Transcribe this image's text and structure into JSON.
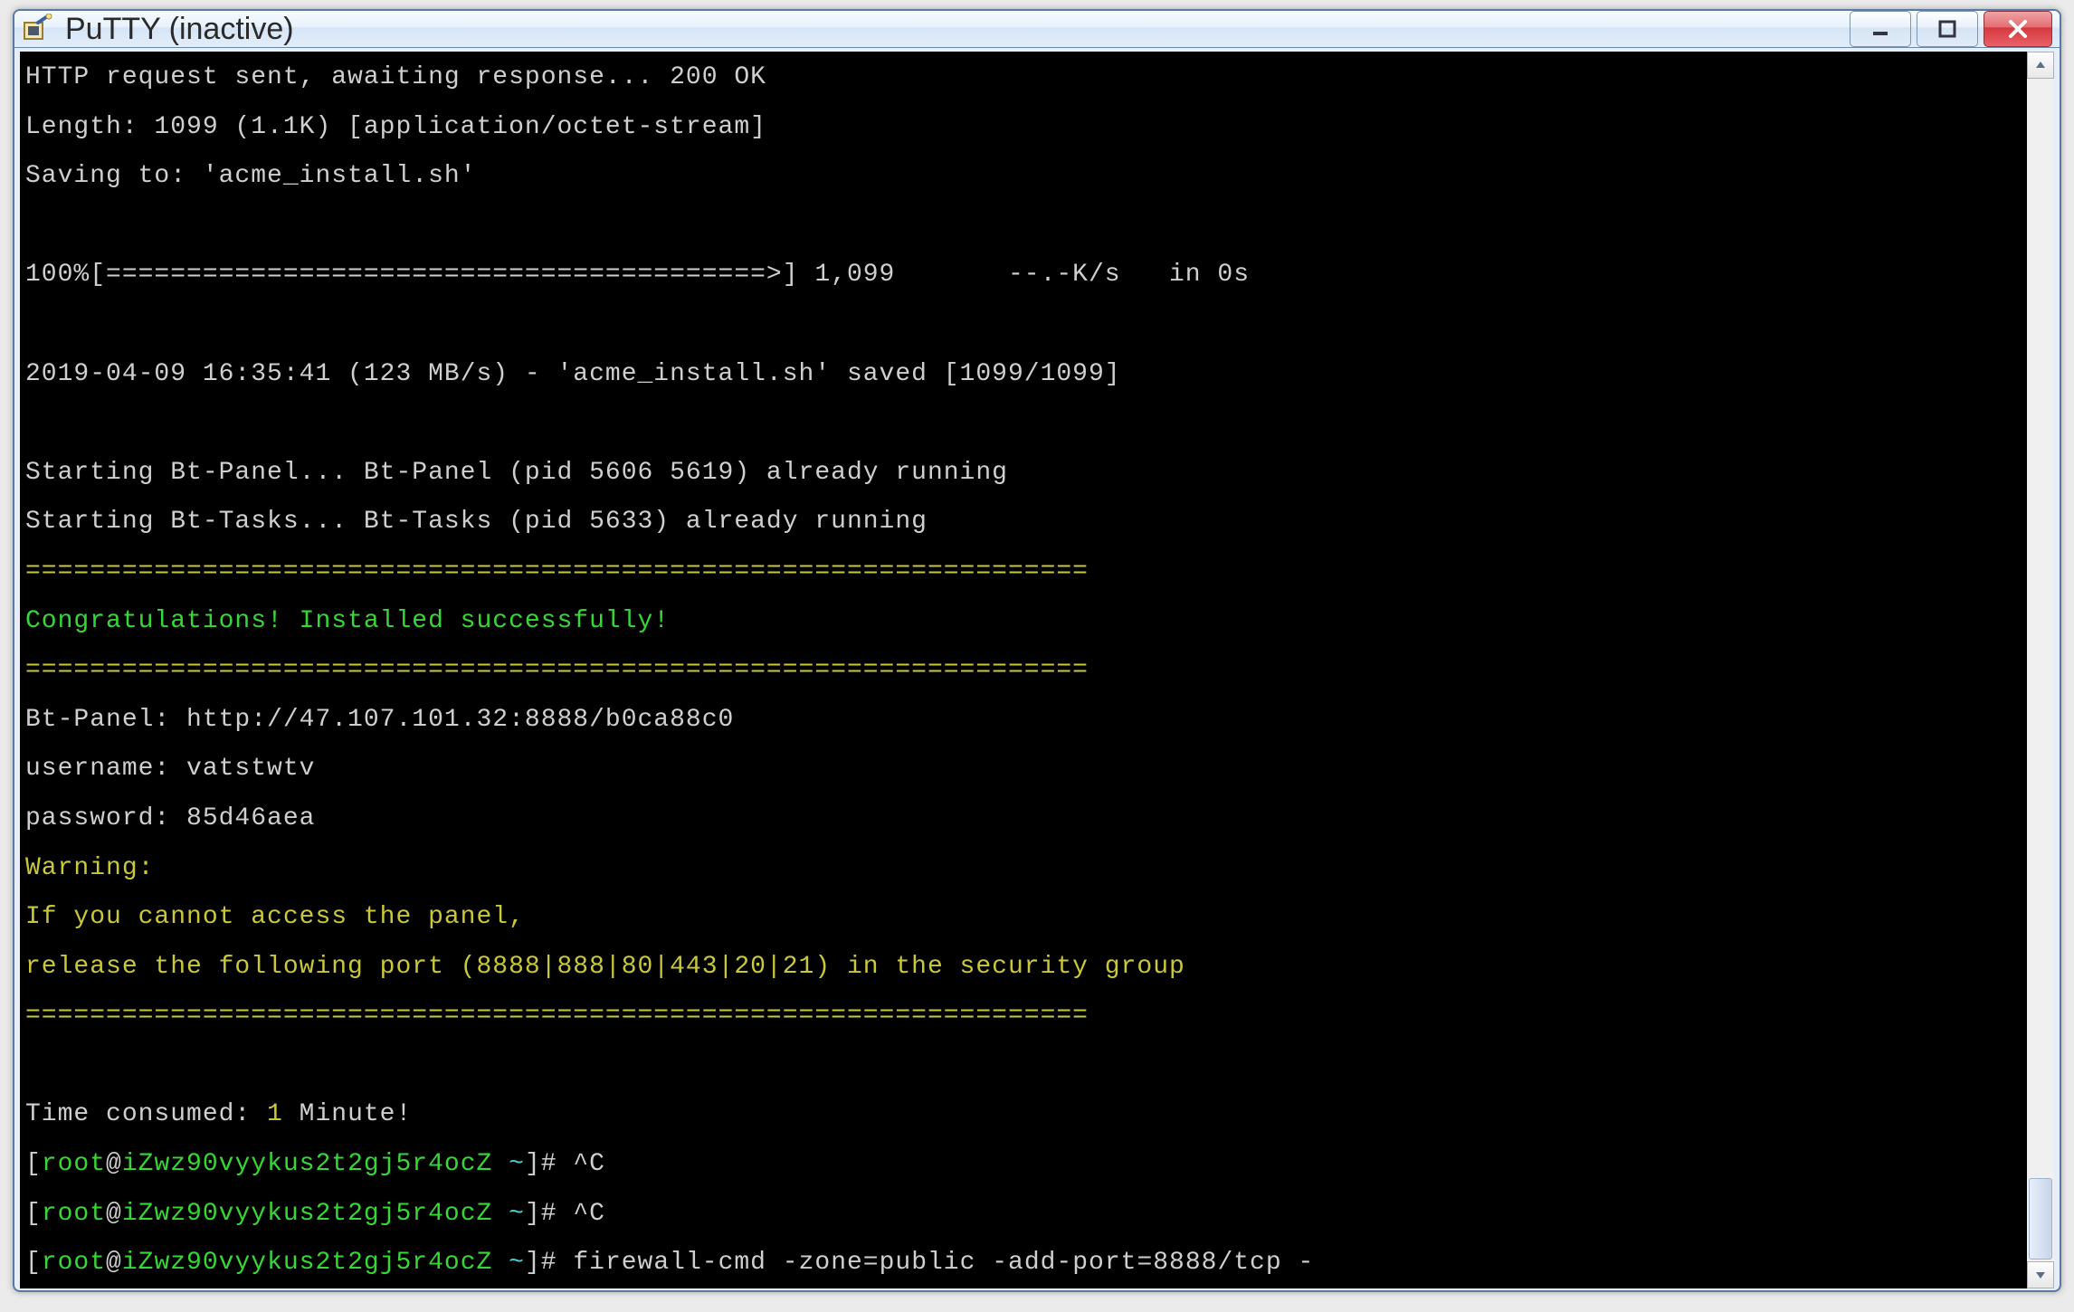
{
  "window": {
    "title": "PuTTY (inactive)"
  },
  "terminal": {
    "lines": [
      {
        "segments": [
          {
            "cls": "",
            "text": "HTTP request sent, awaiting response... 200 OK"
          }
        ]
      },
      {
        "segments": [
          {
            "cls": "",
            "text": "Length: 1099 (1.1K) [application/octet-stream]"
          }
        ]
      },
      {
        "segments": [
          {
            "cls": "",
            "text": "Saving to: 'acme_install.sh'"
          }
        ]
      },
      {
        "segments": [
          {
            "cls": "",
            "text": ""
          }
        ]
      },
      {
        "segments": [
          {
            "cls": "",
            "text": "100%[=========================================>] 1,099       --.-K/s   in 0s"
          }
        ]
      },
      {
        "segments": [
          {
            "cls": "",
            "text": ""
          }
        ]
      },
      {
        "segments": [
          {
            "cls": "",
            "text": "2019-04-09 16:35:41 (123 MB/s) - 'acme_install.sh' saved [1099/1099]"
          }
        ]
      },
      {
        "segments": [
          {
            "cls": "",
            "text": ""
          }
        ]
      },
      {
        "segments": [
          {
            "cls": "",
            "text": "Starting Bt-Panel... Bt-Panel (pid 5606 5619) already running"
          }
        ]
      },
      {
        "segments": [
          {
            "cls": "",
            "text": "Starting Bt-Tasks... Bt-Tasks (pid 5633) already running"
          }
        ]
      },
      {
        "segments": [
          {
            "cls": "y",
            "text": "=================================================================="
          }
        ]
      },
      {
        "segments": [
          {
            "cls": "g",
            "text": "Congratulations! Installed successfully!"
          }
        ]
      },
      {
        "segments": [
          {
            "cls": "y",
            "text": "=================================================================="
          }
        ]
      },
      {
        "segments": [
          {
            "cls": "",
            "text": "Bt-Panel: http://47.107.101.32:8888/b0ca88c0"
          }
        ]
      },
      {
        "segments": [
          {
            "cls": "",
            "text": "username: vatstwtv"
          }
        ]
      },
      {
        "segments": [
          {
            "cls": "",
            "text": "password: 85d46aea"
          }
        ]
      },
      {
        "segments": [
          {
            "cls": "y",
            "text": "Warning:"
          }
        ]
      },
      {
        "segments": [
          {
            "cls": "y",
            "text": "If you cannot access the panel, "
          }
        ]
      },
      {
        "segments": [
          {
            "cls": "y",
            "text": "release the following port (8888|888|80|443|20|21) in the security group"
          }
        ]
      },
      {
        "segments": [
          {
            "cls": "y",
            "text": "=================================================================="
          }
        ]
      },
      {
        "segments": [
          {
            "cls": "",
            "text": ""
          }
        ]
      },
      {
        "segments": [
          {
            "cls": "",
            "text": "Time consumed: "
          },
          {
            "cls": "y",
            "text": "1"
          },
          {
            "cls": "",
            "text": " Minute!"
          }
        ]
      },
      {
        "segments": [
          {
            "cls": "",
            "text": "["
          },
          {
            "cls": "g",
            "text": "root"
          },
          {
            "cls": "",
            "text": "@"
          },
          {
            "cls": "g",
            "text": "iZwz90vyykus2t2gj5r4ocZ"
          },
          {
            "cls": "",
            "text": " "
          },
          {
            "cls": "c",
            "text": "~"
          },
          {
            "cls": "",
            "text": "]# ^C"
          }
        ]
      },
      {
        "segments": [
          {
            "cls": "",
            "text": "["
          },
          {
            "cls": "g",
            "text": "root"
          },
          {
            "cls": "",
            "text": "@"
          },
          {
            "cls": "g",
            "text": "iZwz90vyykus2t2gj5r4ocZ"
          },
          {
            "cls": "",
            "text": " "
          },
          {
            "cls": "c",
            "text": "~"
          },
          {
            "cls": "",
            "text": "]# ^C"
          }
        ]
      },
      {
        "segments": [
          {
            "cls": "",
            "text": "["
          },
          {
            "cls": "g",
            "text": "root"
          },
          {
            "cls": "",
            "text": "@"
          },
          {
            "cls": "g",
            "text": "iZwz90vyykus2t2gj5r4ocZ"
          },
          {
            "cls": "",
            "text": " "
          },
          {
            "cls": "c",
            "text": "~"
          },
          {
            "cls": "",
            "text": "]# firewall-cmd -zone=public -add-port=8888/tcp -"
          }
        ]
      }
    ]
  }
}
